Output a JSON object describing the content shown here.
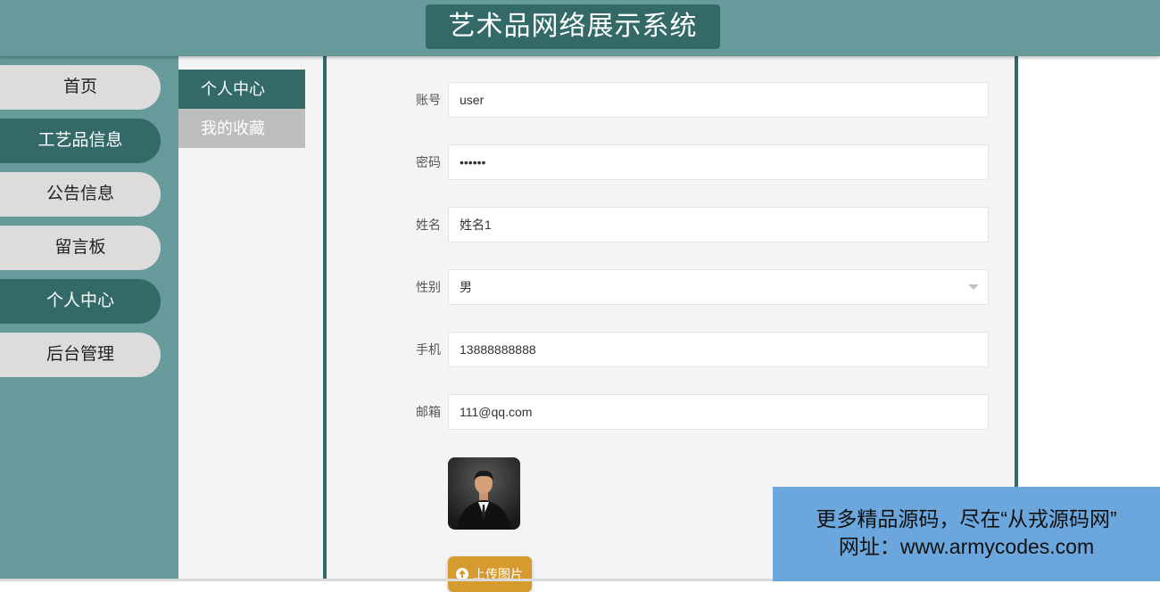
{
  "header": {
    "title": "艺术品网络展示系统"
  },
  "leftnav": {
    "items": [
      {
        "label": "首页",
        "active": false
      },
      {
        "label": "工艺品信息",
        "active": true
      },
      {
        "label": "公告信息",
        "active": false
      },
      {
        "label": "留言板",
        "active": false
      },
      {
        "label": "个人中心",
        "active": true
      },
      {
        "label": "后台管理",
        "active": false
      }
    ]
  },
  "subnav": {
    "items": [
      {
        "label": "个人中心",
        "active": true
      },
      {
        "label": "我的收藏",
        "active": false
      }
    ]
  },
  "form": {
    "account": {
      "label": "账号",
      "value": "user"
    },
    "password": {
      "label": "密码",
      "value": "••••••"
    },
    "name": {
      "label": "姓名",
      "value": "姓名1"
    },
    "gender": {
      "label": "性别",
      "value": "男"
    },
    "phone": {
      "label": "手机",
      "value": "13888888888"
    },
    "email": {
      "label": "邮箱",
      "value": "111@qq.com"
    },
    "upload_label": "上传图片"
  },
  "banner": {
    "line1": "更多精品源码，尽在“从戎源码网”",
    "line2": "网址：www.armycodes.com"
  },
  "colors": {
    "header_bg": "#679a9b",
    "accent": "#336a68",
    "upload_button": "#d69b2e",
    "banner_bg": "#6ba6dc"
  }
}
